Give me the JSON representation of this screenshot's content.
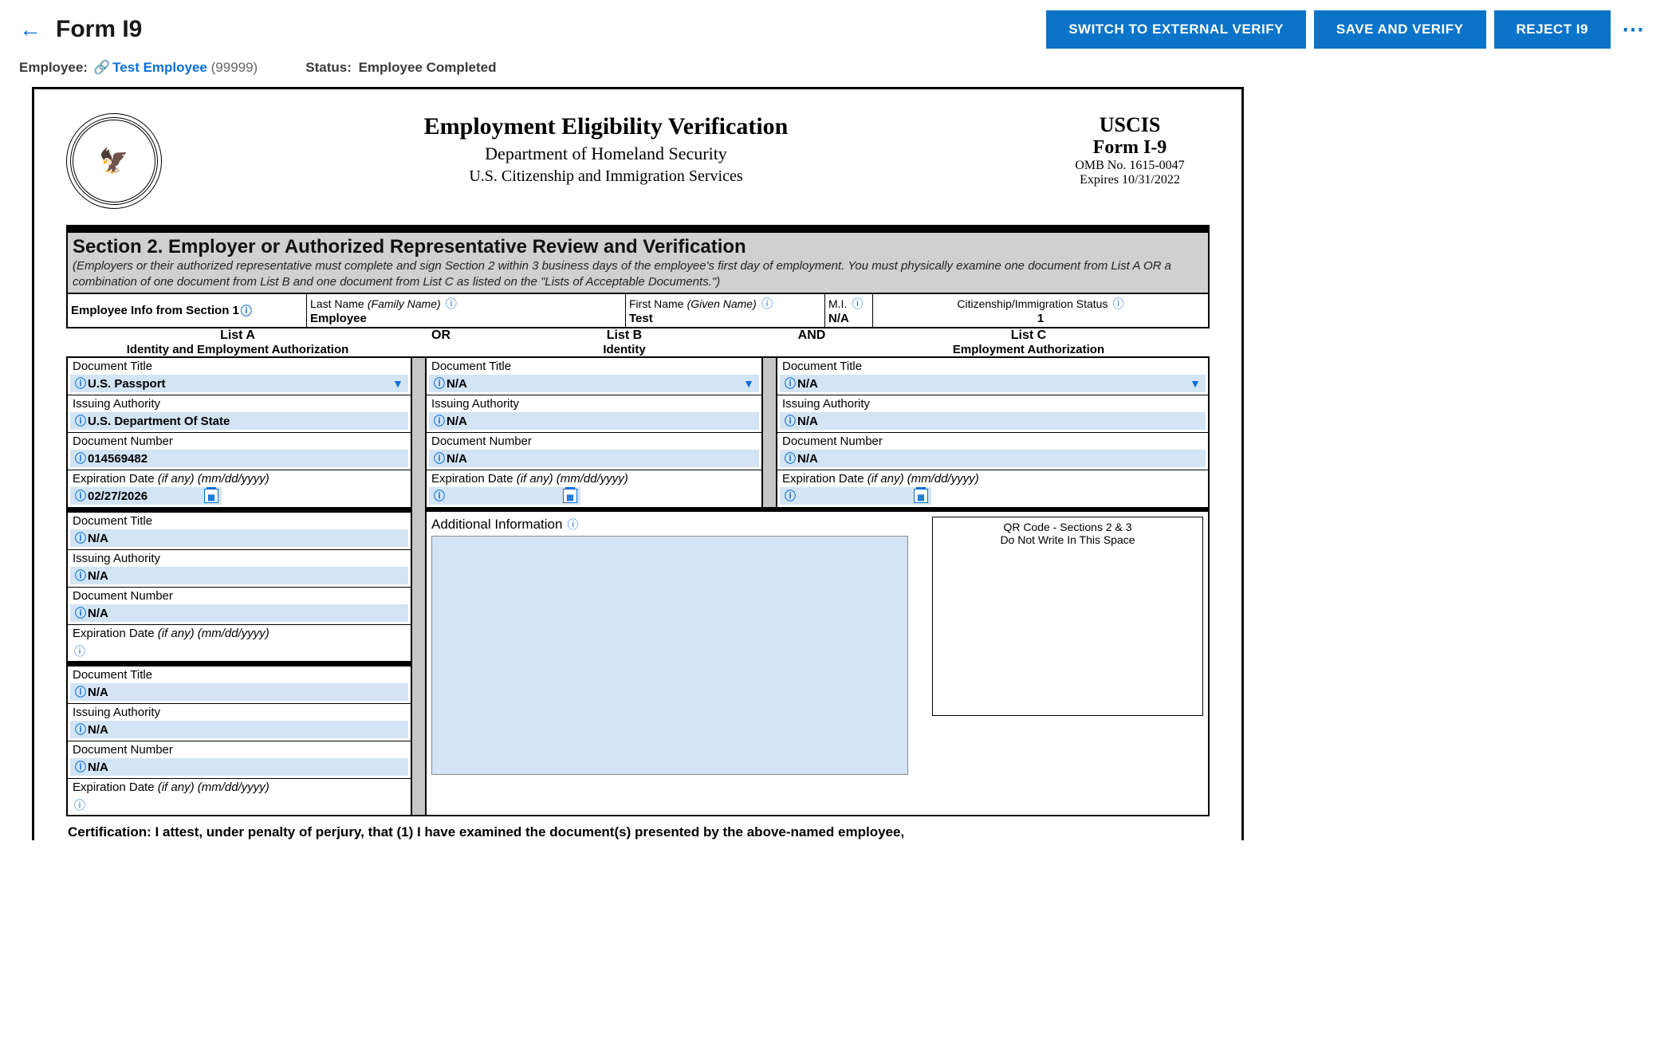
{
  "header": {
    "page_title": "Form I9",
    "buttons": {
      "switch": "SWITCH TO EXTERNAL VERIFY",
      "save": "SAVE AND VERIFY",
      "reject": "REJECT I9"
    }
  },
  "subheader": {
    "employee_label": "Employee:",
    "employee_name": "Test Employee",
    "employee_id": "(99999)",
    "status_label": "Status:",
    "status_value": "Employee Completed"
  },
  "form": {
    "title1": "Employment Eligibility Verification",
    "title2": "Department of Homeland Security",
    "title3": "U.S. Citizenship and Immigration Services",
    "uscis": "USCIS",
    "form_no": "Form I-9",
    "omb": "OMB No. 1615-0047",
    "expires": "Expires 10/31/2022",
    "section2_title": "Section 2. Employer or Authorized Representative Review and Verification",
    "section2_instr": "(Employers or their authorized representative must complete and sign Section 2 within 3 business days of the employee's first day of employment. You must physically examine one document from List A OR a combination of one document from List B and one document from List C as listed on the \"Lists of Acceptable Documents.\")",
    "emp_info_label": "Employee Info from Section 1",
    "last_name_label": "Last Name",
    "last_name_paren": "(Family Name)",
    "last_name_value": "Employee",
    "first_name_label": "First Name",
    "first_name_paren": "(Given Name)",
    "first_name_value": "Test",
    "mi_label": "M.I.",
    "mi_value": "N/A",
    "cit_label": "Citizenship/Immigration Status",
    "cit_value": "1",
    "listA_title": "List A",
    "listA_sub": "Identity and Employment Authorization",
    "listB_title": "List B",
    "listB_sub": "Identity",
    "listC_title": "List C",
    "listC_sub": "Employment Authorization",
    "or": "OR",
    "and": "AND",
    "labels": {
      "doc_title": "Document Title",
      "issuing_auth": "Issuing Authority",
      "doc_number": "Document Number",
      "exp_date_pre": "Expiration Date",
      "exp_date_ital": "(if any) (mm/dd/yyyy)"
    },
    "listA": [
      {
        "doc_title": "U.S. Passport",
        "issuing_auth": "U.S. Department Of State",
        "doc_number": "014569482",
        "exp_date": "02/27/2026"
      },
      {
        "doc_title": "N/A",
        "issuing_auth": "N/A",
        "doc_number": "N/A",
        "exp_date": ""
      },
      {
        "doc_title": "N/A",
        "issuing_auth": "N/A",
        "doc_number": "N/A",
        "exp_date": ""
      }
    ],
    "listB": {
      "doc_title": "N/A",
      "issuing_auth": "N/A",
      "doc_number": "N/A",
      "exp_date": ""
    },
    "listC": {
      "doc_title": "N/A",
      "issuing_auth": "N/A",
      "doc_number": "N/A",
      "exp_date": ""
    },
    "addl_info_label": "Additional Information",
    "qr_line1": "QR Code - Sections 2 & 3",
    "qr_line2": "Do Not Write In This Space",
    "certification": "Certification: I attest, under penalty of perjury, that (1) I have examined the document(s) presented by the above-named employee,"
  }
}
